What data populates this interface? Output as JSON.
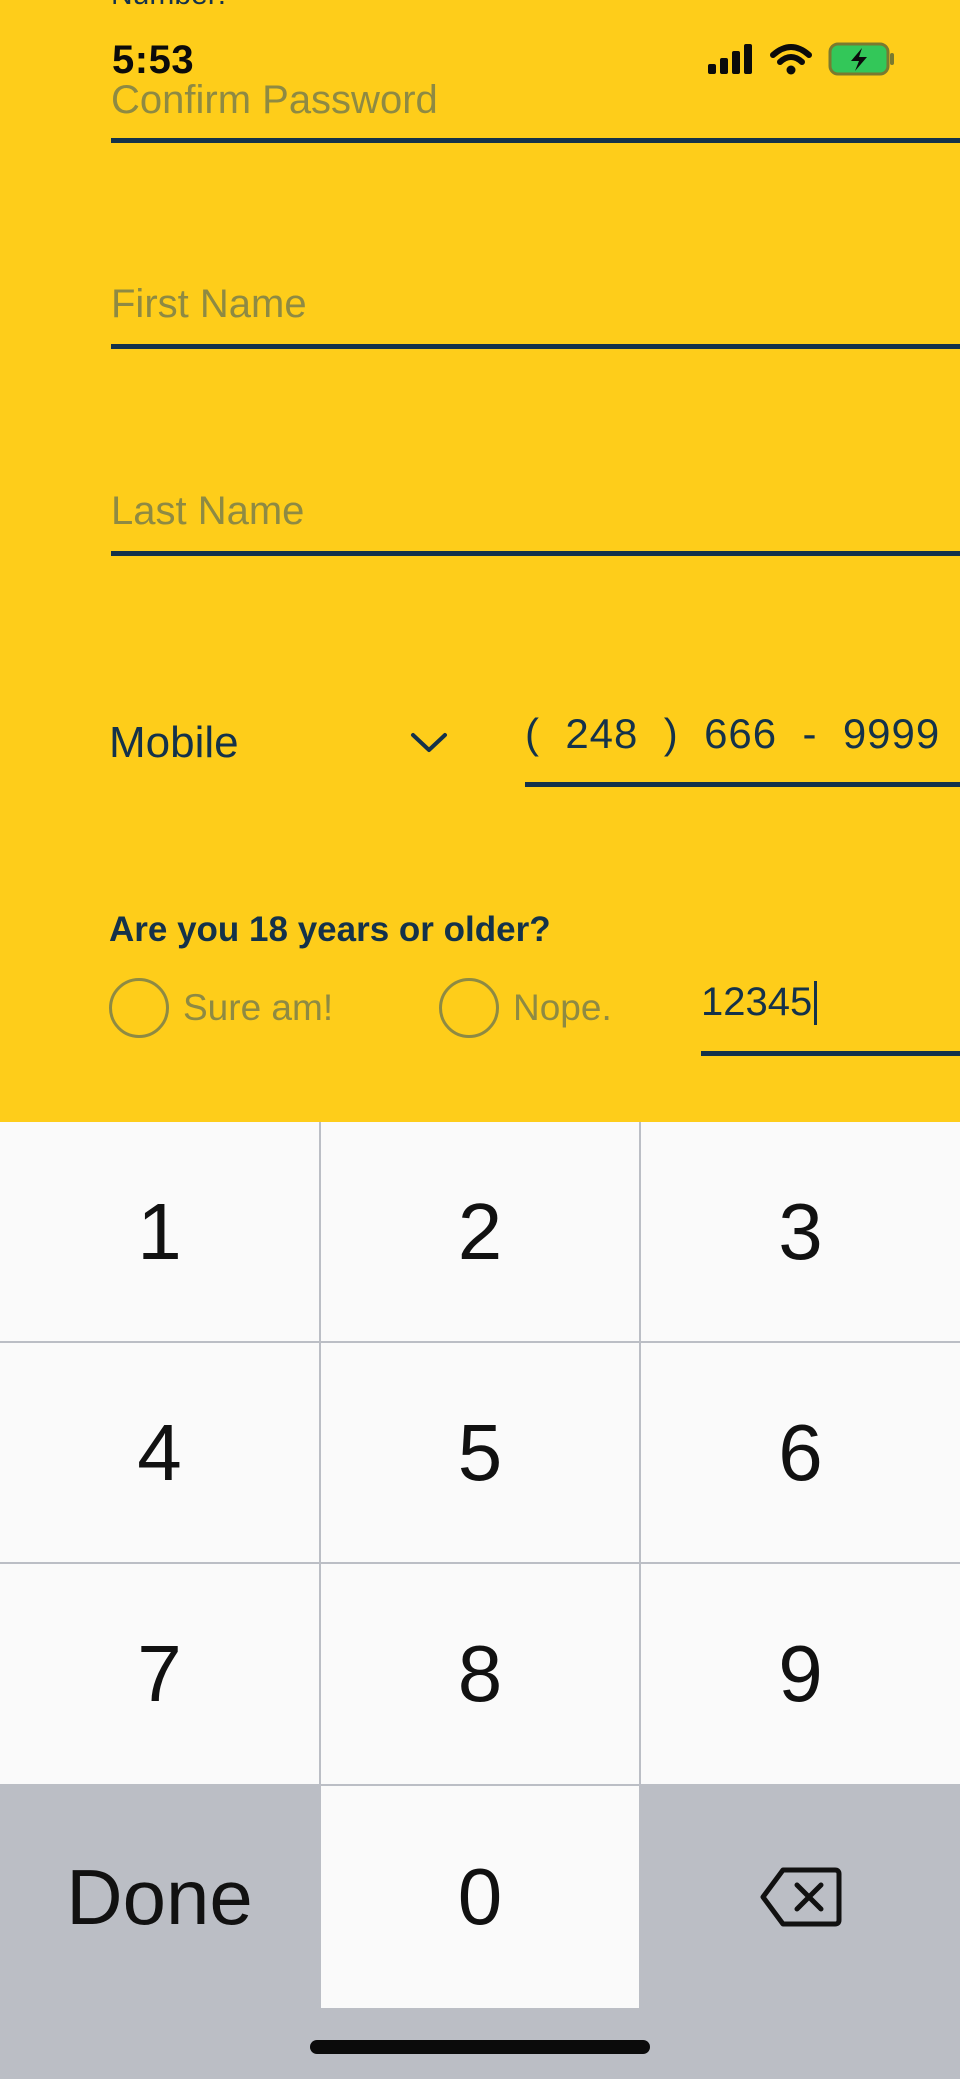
{
  "status_bar": {
    "time": "5:53",
    "icons": [
      "cellular-signal-icon",
      "wifi-icon",
      "battery-charging-icon"
    ],
    "battery_color": "#33c759"
  },
  "form": {
    "cutoff_label": "Number:",
    "confirm_password": {
      "placeholder": "Confirm Password"
    },
    "first_name": {
      "placeholder": "First Name"
    },
    "last_name": {
      "placeholder": "Last Name"
    },
    "phone_type": {
      "value": "Mobile"
    },
    "phone_number": {
      "area": "248",
      "prefix": "666",
      "line": "9999"
    },
    "age_question": "Are you 18 years or older?",
    "age_options": [
      "Sure am!",
      "Nope."
    ],
    "zip": {
      "value": "12345"
    }
  },
  "keypad": {
    "keys": [
      "1",
      "2",
      "3",
      "4",
      "5",
      "6",
      "7",
      "8",
      "9"
    ],
    "done_label": "Done",
    "zero_label": "0",
    "delete_icon": "backspace-icon"
  },
  "colors": {
    "background": "#fecd1a",
    "text_primary": "#14324a",
    "placeholder": "#8e8a43"
  }
}
